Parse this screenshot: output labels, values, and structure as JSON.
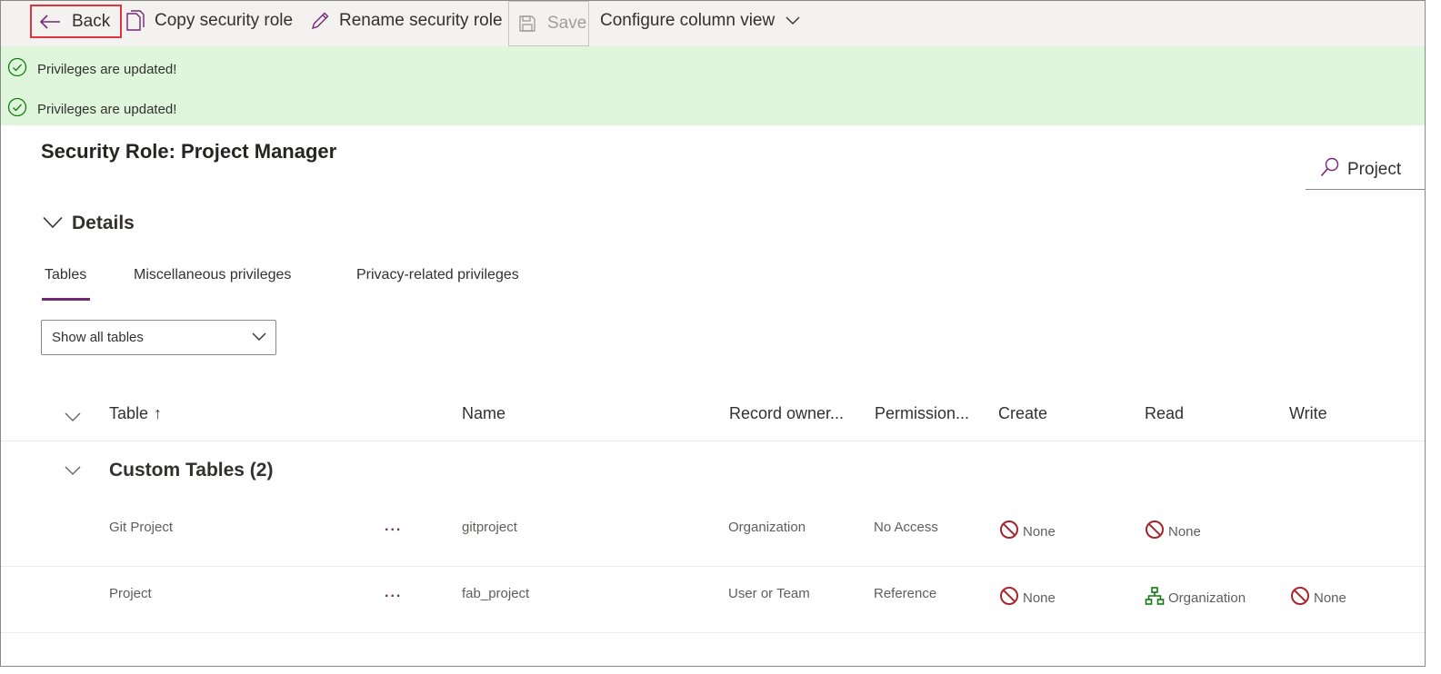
{
  "toolbar": {
    "back_label": "Back",
    "copy_label": "Copy security role",
    "rename_label": "Rename security role",
    "save_label": "Save",
    "configure_label": "Configure column view"
  },
  "notifications": [
    {
      "text": "Privileges are updated!"
    },
    {
      "text": "Privileges are updated!"
    }
  ],
  "page": {
    "title": "Security Role: Project Manager",
    "search_value": "Project",
    "details_label": "Details"
  },
  "tabs": [
    {
      "label": "Tables",
      "selected": true
    },
    {
      "label": "Miscellaneous privileges",
      "selected": false
    },
    {
      "label": "Privacy-related privileges",
      "selected": false
    }
  ],
  "filter": {
    "selected": "Show all tables"
  },
  "table": {
    "columns": {
      "table": "Table",
      "sort_indicator": "↑",
      "name": "Name",
      "record_owner": "Record owner...",
      "permission": "Permission...",
      "create": "Create",
      "read": "Read",
      "write": "Write"
    },
    "group": {
      "title": "Custom Tables (2)"
    },
    "rows": [
      {
        "table": "Git Project",
        "more": "...",
        "name": "gitproject",
        "record_owner": "Organization",
        "permission": "No Access",
        "create": "None",
        "read": "None"
      },
      {
        "table": "Project",
        "more": "...",
        "name": "fab_project",
        "record_owner": "User or Team",
        "permission": "Reference",
        "create": "None",
        "read": "Organization",
        "write": "None"
      }
    ]
  },
  "colors": {
    "accent": "#742774",
    "success_bg": "#dff6dd",
    "success_icon": "#107c10",
    "none_icon": "#a4262c",
    "highlight_border": "#e0343f"
  }
}
